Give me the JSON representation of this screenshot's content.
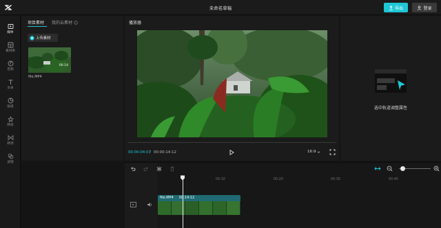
{
  "app": {
    "title": "未命名草稿"
  },
  "header": {
    "export_label": "导出",
    "login_label": "登录"
  },
  "rail": {
    "items": [
      {
        "label": "媒体",
        "icon": "media-icon",
        "active": true
      },
      {
        "label": "素材库",
        "icon": "library-icon",
        "active": false
      },
      {
        "label": "音频",
        "icon": "audio-icon",
        "active": false
      },
      {
        "label": "文本",
        "icon": "text-icon",
        "active": false
      },
      {
        "label": "贴纸",
        "icon": "sticker-icon",
        "active": false
      },
      {
        "label": "特效",
        "icon": "effects-icon",
        "active": false
      },
      {
        "label": "转场",
        "icon": "transition-icon",
        "active": false
      },
      {
        "label": "滤镜",
        "icon": "filter-icon",
        "active": false
      }
    ]
  },
  "media_panel": {
    "tab_project": "项目素材",
    "tab_cloud": "我的云素材",
    "upload_label": "上传素材",
    "item": {
      "filename": "file.MP4",
      "duration": "00:14"
    }
  },
  "player": {
    "label": "播放器",
    "current_time": "00:00:04:07",
    "separator": "/",
    "total_time": "00:00:14:12",
    "aspect_ratio": "16:9"
  },
  "properties": {
    "hint": "选中轨道调整属性"
  },
  "timeline": {
    "ticks": [
      "00:10",
      "00:20",
      "00:30",
      "00:40"
    ],
    "clip": {
      "name": "file.MP4",
      "duration": "00:14:12"
    }
  },
  "colors": {
    "accent": "#1fc7d6",
    "clip": "#1f6a73",
    "background": "#141414",
    "panel": "#1b1b1b"
  }
}
